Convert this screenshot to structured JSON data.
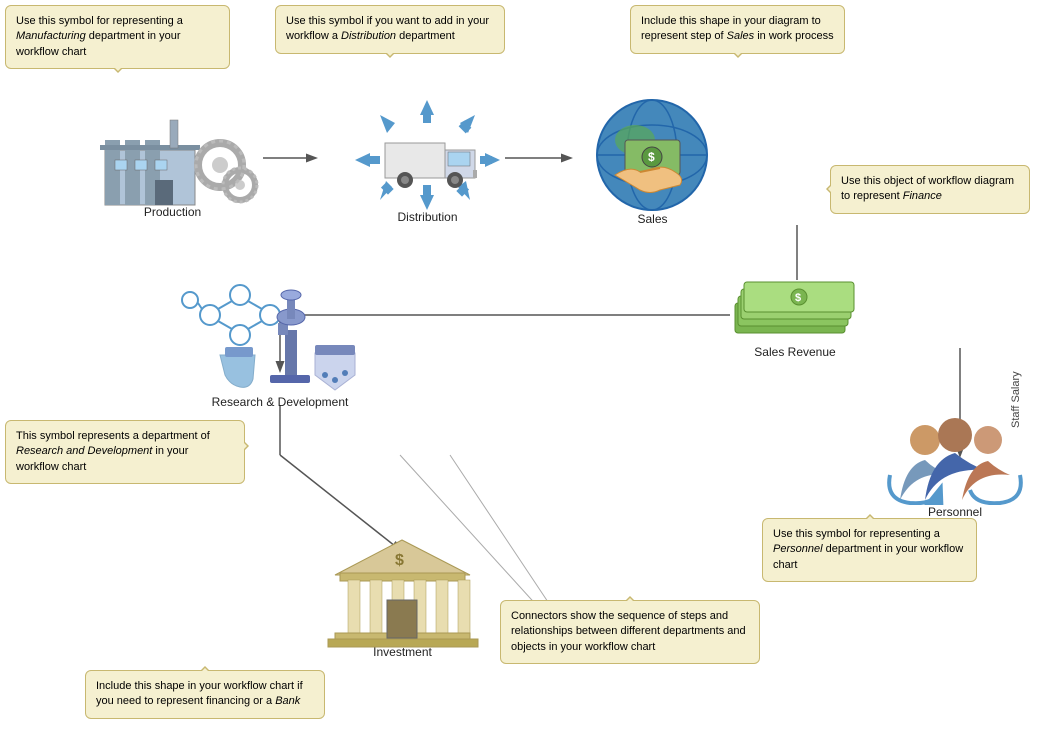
{
  "tooltips": {
    "manufacturing": "Use this symbol for representing a <em>Manufacturing</em> department in your workflow chart",
    "distribution": "Use this symbol if you want to add in your workflow a <em>Distribution</em> department",
    "sales": "Include this shape in your diagram to represent step of <em>Sales</em> in work process",
    "finance": "Use this object of workflow diagram to represent <em>Finance</em>",
    "research": "This symbol represents a department of <em>Research and Development</em> in your workflow chart",
    "personnel": "Use this symbol for representing a <em>Personnel</em> department in your workflow chart",
    "connectors": "Connectors show the sequence of steps and relationships between different departments and objects in your workflow chart",
    "investment": "Include this shape in your workflow chart if you need to represent financing or a <em>Bank</em>"
  },
  "labels": {
    "production": "Production",
    "distribution": "Distribution",
    "sales": "Sales",
    "salesRevenue": "Sales Revenue",
    "research": "Research & Development",
    "personnel": "Personnel",
    "investment": "Investment",
    "staffSalary": "Staff Salary"
  }
}
